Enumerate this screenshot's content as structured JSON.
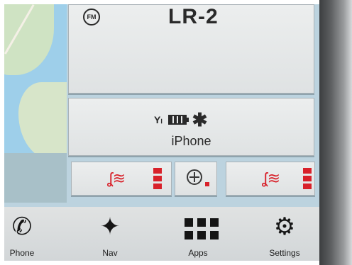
{
  "radio": {
    "band_icon": "fm-icon",
    "band_label": "FM",
    "station": "LR-2"
  },
  "phone": {
    "signal_icon": "signal-icon",
    "battery_icon": "battery-icon",
    "bluetooth_icon": "bluetooth-icon",
    "device_name": "iPhone"
  },
  "climate": {
    "left_seat": {
      "icon": "heated-seat-icon",
      "level": 3,
      "max_level": 3
    },
    "defrost": {
      "icon": "heated-steering-wheel-icon",
      "active": true
    },
    "right_seat": {
      "icon": "heated-seat-icon",
      "level": 3,
      "max_level": 3
    }
  },
  "navbar": {
    "items": [
      {
        "label": "Phone",
        "icon": "phone-icon"
      },
      {
        "label": "Nav",
        "icon": "navigation-icon"
      },
      {
        "label": "Apps",
        "icon": "apps-icon"
      },
      {
        "label": "Settings",
        "icon": "settings-icon"
      }
    ]
  },
  "colors": {
    "accent_red": "#d8212a",
    "tile_bg": "#e6e8e9",
    "screen_bg": "#bcd3df"
  }
}
